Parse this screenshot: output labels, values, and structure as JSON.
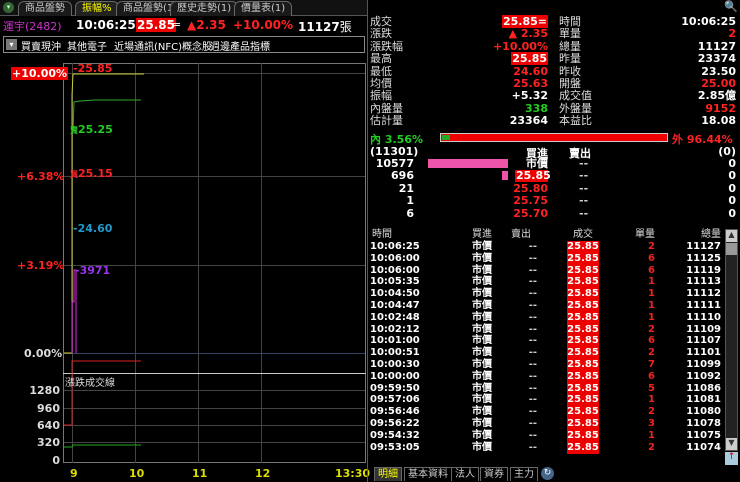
{
  "tabs": [
    "商品盤勢",
    "振幅%",
    "商品盤勢(1)",
    "歷史走勢(1)",
    "價量表(1)"
  ],
  "header": {
    "stock": "運宇(2482)",
    "time": "10:06:25",
    "price": "25.85",
    "flat": "=",
    "change": "▲2.35",
    "pct": "+10.00%",
    "volume": "11127",
    "unit": "張"
  },
  "categories": [
    "買賣現沖",
    "其他電子",
    "近場通訊(NFC)概念股",
    "週邊產品指標"
  ],
  "chart": {
    "y_labels": [
      "+10.00%",
      "+6.38%",
      "+3.19%",
      "0.00%"
    ],
    "markers": {
      "high": "25.85",
      "avg": "25.25",
      "bid": "25.15",
      "low": "24.60",
      "vol": "3971"
    },
    "bid_prefix": "買",
    "ask_prefix": "賣",
    "sub_title": "漲跌成交線",
    "sub_labels": [
      "1280",
      "960",
      "640",
      "320",
      "0"
    ],
    "x_labels": [
      "9",
      "10",
      "11",
      "12",
      "13:30"
    ]
  },
  "chart_data": {
    "type": "line",
    "x_labels": [
      "9",
      "10",
      "11",
      "12",
      "13:30"
    ],
    "ylim_pct": [
      0,
      10
    ],
    "price_pct_end": 10.0,
    "avg_price": 25.25,
    "high": 25.85,
    "low": 24.6
  },
  "quote": {
    "left": [
      [
        "成交",
        "25.85="
      ],
      [
        "漲跌",
        "▲ 2.35"
      ],
      [
        "漲跌幅",
        "+10.00%"
      ],
      [
        "最高",
        "25.85"
      ],
      [
        "最低",
        "24.60"
      ],
      [
        "均價",
        "25.63"
      ],
      [
        "振幅",
        "+5.32"
      ],
      [
        "內盤量",
        "338"
      ],
      [
        "估計量",
        "23364"
      ]
    ],
    "right": [
      [
        "時間",
        "10:06:25"
      ],
      [
        "單量",
        "2"
      ],
      [
        "總量",
        "11127"
      ],
      [
        "昨量",
        "23374"
      ],
      [
        "昨收",
        "23.50"
      ],
      [
        "開盤",
        "25.00"
      ],
      [
        "成交值",
        "2.85億"
      ],
      [
        "外盤量",
        "9152"
      ],
      [
        "本益比",
        "18.08"
      ]
    ],
    "inner": "內 3.56%",
    "outer": "外 96.44%",
    "inner_pct": 3.56
  },
  "book": {
    "buy_total": "(11301)",
    "buy_label": "買進",
    "sell_label": "賣出",
    "sell_total": "(0)",
    "rows": [
      [
        "10577",
        "市價",
        "--",
        "0"
      ],
      [
        "696",
        "25.85",
        "--",
        "0"
      ],
      [
        "21",
        "25.80",
        "--",
        "0"
      ],
      [
        "1",
        "25.75",
        "--",
        "0"
      ],
      [
        "6",
        "25.70",
        "--",
        "0"
      ]
    ]
  },
  "ticks": {
    "headers": [
      "時間",
      "買進",
      "賣出",
      "成交",
      "單量",
      "總量"
    ],
    "rows": [
      [
        "10:06:25",
        "市價",
        "--",
        "25.85",
        "2",
        "11127"
      ],
      [
        "10:06:00",
        "市價",
        "--",
        "25.85",
        "6",
        "11125"
      ],
      [
        "10:06:00",
        "市價",
        "--",
        "25.85",
        "6",
        "11119"
      ],
      [
        "10:05:35",
        "市價",
        "--",
        "25.85",
        "1",
        "11113"
      ],
      [
        "10:04:50",
        "市價",
        "--",
        "25.85",
        "1",
        "11112"
      ],
      [
        "10:04:47",
        "市價",
        "--",
        "25.85",
        "1",
        "11111"
      ],
      [
        "10:02:48",
        "市價",
        "--",
        "25.85",
        "1",
        "11110"
      ],
      [
        "10:02:12",
        "市價",
        "--",
        "25.85",
        "2",
        "11109"
      ],
      [
        "10:01:00",
        "市價",
        "--",
        "25.85",
        "6",
        "11107"
      ],
      [
        "10:00:51",
        "市價",
        "--",
        "25.85",
        "2",
        "11101"
      ],
      [
        "10:00:30",
        "市價",
        "--",
        "25.85",
        "7",
        "11099"
      ],
      [
        "10:00:00",
        "市價",
        "--",
        "25.85",
        "6",
        "11092"
      ],
      [
        "09:59:50",
        "市價",
        "--",
        "25.85",
        "5",
        "11086"
      ],
      [
        "09:57:06",
        "市價",
        "--",
        "25.85",
        "1",
        "11081"
      ],
      [
        "09:56:46",
        "市價",
        "--",
        "25.85",
        "2",
        "11080"
      ],
      [
        "09:56:22",
        "市價",
        "--",
        "25.85",
        "3",
        "11078"
      ],
      [
        "09:54:32",
        "市價",
        "--",
        "25.85",
        "1",
        "11075"
      ],
      [
        "09:53:05",
        "市價",
        "--",
        "25.85",
        "2",
        "11074"
      ]
    ]
  },
  "bottom_tabs": [
    "明細",
    "基本資料",
    "法人",
    "資券",
    "主力"
  ]
}
